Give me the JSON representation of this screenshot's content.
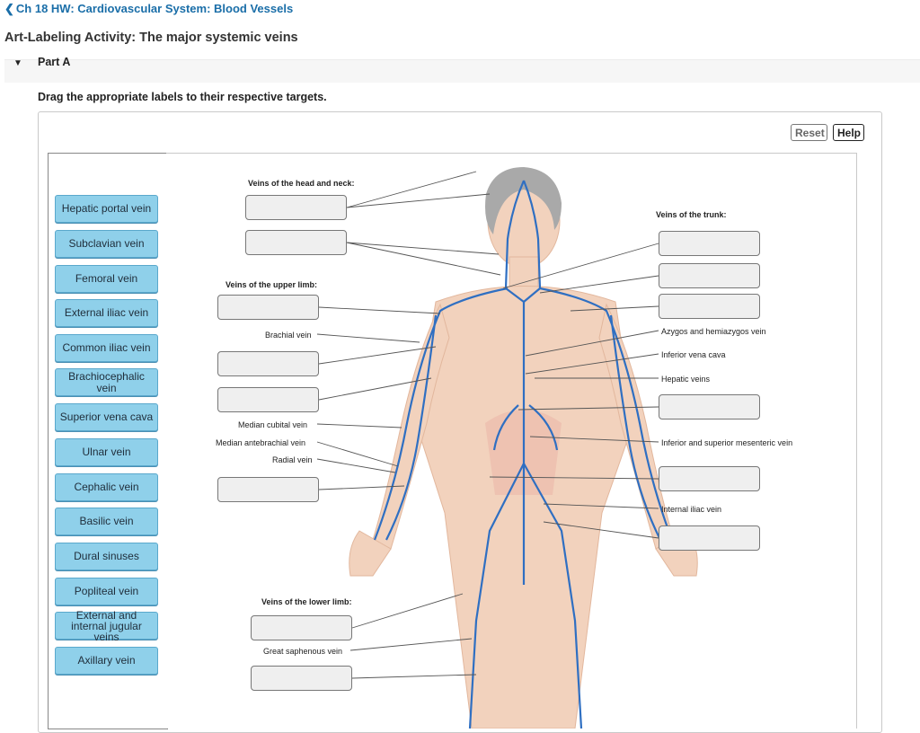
{
  "header": {
    "back_label": "Ch 18 HW: Cardiovascular System: Blood Vessels",
    "activity_title": "Art-Labeling Activity: The major systemic veins"
  },
  "part": {
    "label": "Part A"
  },
  "instructions": "Drag the appropriate labels to their respective targets.",
  "toolbar": {
    "reset_label": "Reset",
    "help_label": "Help"
  },
  "label_bank": [
    "Hepatic portal vein",
    "Subclavian vein",
    "Femoral vein",
    "External iliac vein",
    "Common iliac vein",
    "Brachiocephalic vein",
    "Superior vena cava",
    "Ulnar vein",
    "Cephalic vein",
    "Basilic vein",
    "Dural sinuses",
    "Popliteal vein",
    "External and internal jugular veins",
    "Axillary vein"
  ],
  "diagram": {
    "headings": {
      "head_neck": "Veins of the head and neck:",
      "upper_limb": "Veins of the upper limb:",
      "trunk": "Veins of the trunk:",
      "lower_limb": "Veins of the lower limb:"
    },
    "fixed_labels": {
      "brachial": "Brachial vein",
      "median_cubital": "Median cubital vein",
      "median_antebrachial": "Median antebrachial vein",
      "radial": "Radial vein",
      "azygos": "Azygos and hemiazygos vein",
      "ivc": "Inferior vena cava",
      "hepatic": "Hepatic veins",
      "mesenteric": "Inferior and superior mesenteric vein",
      "internal_iliac": "Internal iliac vein",
      "great_saphenous": "Great saphenous vein"
    }
  },
  "colors": {
    "tile": "#8fd0ea",
    "link": "#1a6ea8",
    "vein": "#2f6fc2",
    "skin": "#f2d2bd"
  }
}
